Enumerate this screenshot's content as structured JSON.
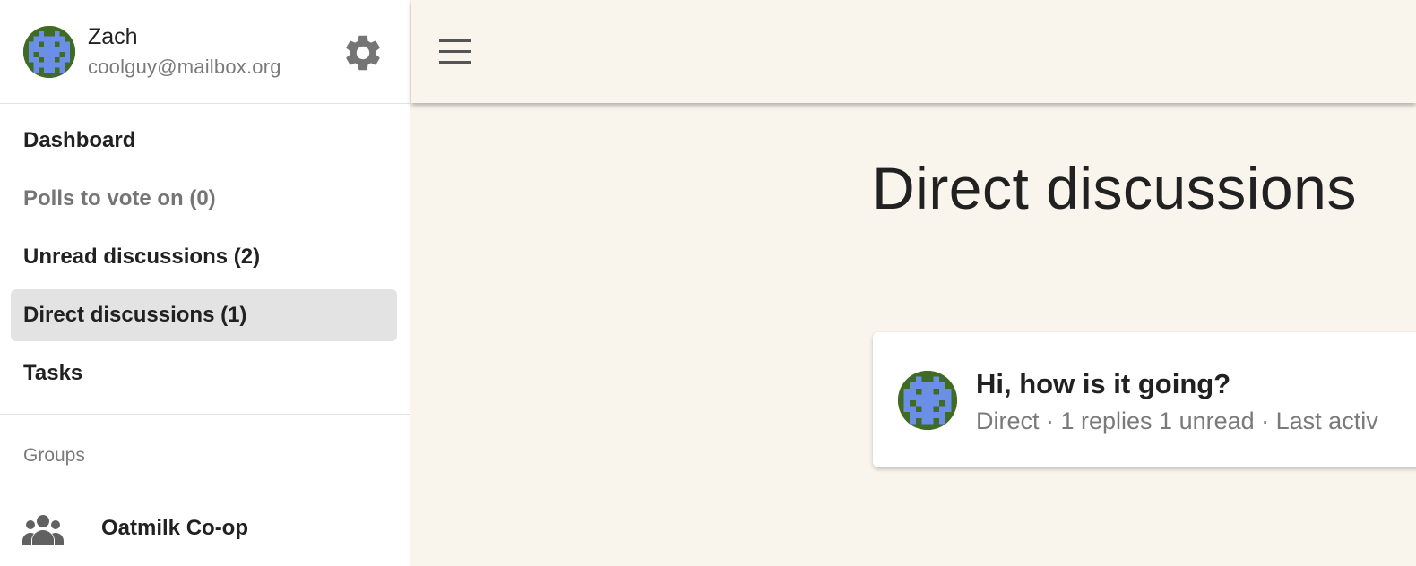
{
  "user": {
    "name": "Zach",
    "email": "coolguy@mailbox.org",
    "avatar_icon": "pixel-avatar-icon",
    "avatar_colors": {
      "background": "#3f6b24",
      "pattern": "#6b8fe6"
    }
  },
  "nav": {
    "items": [
      {
        "label": "Dashboard",
        "state": "normal"
      },
      {
        "label": "Polls to vote on (0)",
        "state": "muted"
      },
      {
        "label": "Unread discussions (2)",
        "state": "normal"
      },
      {
        "label": "Direct discussions (1)",
        "state": "active"
      },
      {
        "label": "Tasks",
        "state": "normal"
      }
    ]
  },
  "groups": {
    "label": "Groups",
    "items": [
      {
        "label": "Oatmilk Co-op",
        "icon": "people-icon"
      }
    ]
  },
  "main": {
    "title": "Direct discussions",
    "discussions": [
      {
        "title": "Hi, how is it going?",
        "meta": "Direct · 1 replies 1 unread · Last activ"
      }
    ]
  },
  "colors": {
    "page_background": "#f9f5ec",
    "sidebar_background": "#ffffff",
    "active_nav_background": "#e3e3e3",
    "icon_gray": "#757575"
  }
}
